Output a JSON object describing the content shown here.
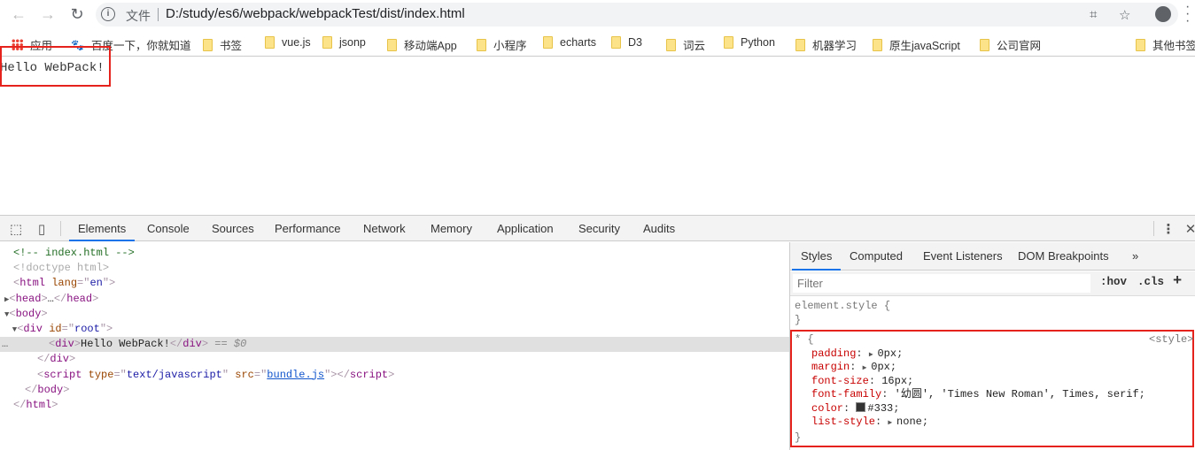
{
  "browser": {
    "scheme_label": "文件",
    "url": "D:/study/es6/webpack/webpackTest/dist/index.html",
    "bookmarks": [
      {
        "label": "应用",
        "icon": "apps-icon"
      },
      {
        "label": "百度一下，你就知道",
        "icon": "baidu-icon"
      },
      {
        "label": "书签",
        "icon": "folder-icon"
      },
      {
        "label": "vue.js",
        "icon": "folder-icon"
      },
      {
        "label": "jsonp",
        "icon": "folder-icon"
      },
      {
        "label": "移动端App",
        "icon": "folder-icon"
      },
      {
        "label": "小程序",
        "icon": "folder-icon"
      },
      {
        "label": "echarts",
        "icon": "folder-icon"
      },
      {
        "label": "D3",
        "icon": "folder-icon"
      },
      {
        "label": "词云",
        "icon": "folder-icon"
      },
      {
        "label": "Python",
        "icon": "folder-icon"
      },
      {
        "label": "机器学习",
        "icon": "folder-icon"
      },
      {
        "label": "原生javaScript",
        "icon": "folder-icon"
      },
      {
        "label": "公司官网",
        "icon": "folder-icon"
      },
      {
        "label": "其他书签",
        "icon": "folder-icon"
      }
    ]
  },
  "page": {
    "text": "Hello WebPack!"
  },
  "devtools": {
    "tabs": [
      "Elements",
      "Console",
      "Sources",
      "Performance",
      "Network",
      "Memory",
      "Application",
      "Security",
      "Audits"
    ],
    "active_tab": "Elements",
    "dom_lines": [
      [
        [
          "t-comment",
          "<!-- index.html -->"
        ]
      ],
      [
        [
          "t-doctype",
          "<!doctype html>"
        ]
      ],
      [
        [
          "t-br",
          "<"
        ],
        [
          "t-tag",
          "html"
        ],
        [
          "t-text",
          " "
        ],
        [
          "t-attr",
          "lang"
        ],
        [
          "t-br",
          "=\""
        ],
        [
          "t-val",
          "en"
        ],
        [
          "t-br",
          "\">"
        ]
      ],
      [
        [
          "t-tri",
          "▶"
        ],
        [
          "t-br",
          "<"
        ],
        [
          "t-tag",
          "head"
        ],
        [
          "t-br",
          ">"
        ],
        [
          "t-text",
          "…"
        ],
        [
          "t-br",
          "</"
        ],
        [
          "t-tag",
          "head"
        ],
        [
          "t-br",
          ">"
        ]
      ],
      [
        [
          "t-tri",
          "▼"
        ],
        [
          "t-br",
          "<"
        ],
        [
          "t-tag",
          "body"
        ],
        [
          "t-br",
          ">"
        ]
      ],
      [
        [
          "t-tri",
          "  ▼"
        ],
        [
          "t-br",
          "<"
        ],
        [
          "t-tag",
          "div"
        ],
        [
          "t-text",
          " "
        ],
        [
          "t-attr",
          "id"
        ],
        [
          "t-br",
          "=\""
        ],
        [
          "t-val",
          "root"
        ],
        [
          "t-br",
          "\">"
        ]
      ],
      [
        [
          "t-br",
          "<"
        ],
        [
          "t-tag",
          "div"
        ],
        [
          "t-br",
          ">"
        ],
        [
          "t-text",
          "Hello WebPack!"
        ],
        [
          "t-br",
          "</"
        ],
        [
          "t-tag",
          "div"
        ],
        [
          "t-br",
          ">"
        ],
        [
          "t-eq",
          " == $0"
        ]
      ],
      [
        [
          "t-br",
          "</"
        ],
        [
          "t-tag",
          "div"
        ],
        [
          "t-br",
          ">"
        ]
      ],
      [
        [
          "t-br",
          "<"
        ],
        [
          "t-tag",
          "script"
        ],
        [
          "t-text",
          " "
        ],
        [
          "t-attr",
          "type"
        ],
        [
          "t-br",
          "=\""
        ],
        [
          "t-val",
          "text/javascript"
        ],
        [
          "t-br",
          "\" "
        ],
        [
          "t-attr",
          "src"
        ],
        [
          "t-br",
          "=\""
        ],
        [
          "t-link",
          "bundle.js"
        ],
        [
          "t-br",
          "\"></"
        ],
        [
          "t-tag",
          "script"
        ],
        [
          "t-br",
          ">"
        ]
      ],
      [
        [
          "t-br",
          "</"
        ],
        [
          "t-tag",
          "body"
        ],
        [
          "t-br",
          ">"
        ]
      ],
      [
        [
          "t-br",
          "</"
        ],
        [
          "t-tag",
          "html"
        ],
        [
          "t-br",
          ">"
        ]
      ]
    ],
    "selected_line": 6,
    "ellipsis": "…",
    "styles": {
      "tabs": [
        "Styles",
        "Computed",
        "Event Listeners",
        "DOM Breakpoints"
      ],
      "more": "»",
      "filter_placeholder": "Filter",
      "hov": ":hov",
      "cls": ".cls",
      "add": "+",
      "element_style_open": "element.style {",
      "close_brace": "}",
      "rule_selector": "* {",
      "rule_source": "<style>",
      "props": [
        {
          "name": "padding",
          "value": "0px",
          "expand": true
        },
        {
          "name": "margin",
          "value": "0px",
          "expand": true
        },
        {
          "name": "font-size",
          "value": "16px",
          "expand": false
        },
        {
          "name": "font-family",
          "value": "'幼圆', 'Times New Roman', Times, serif",
          "expand": false
        },
        {
          "name": "color",
          "value": "#333",
          "expand": false,
          "swatch": "#333333"
        },
        {
          "name": "list-style",
          "value": "none",
          "expand": true
        }
      ]
    }
  }
}
